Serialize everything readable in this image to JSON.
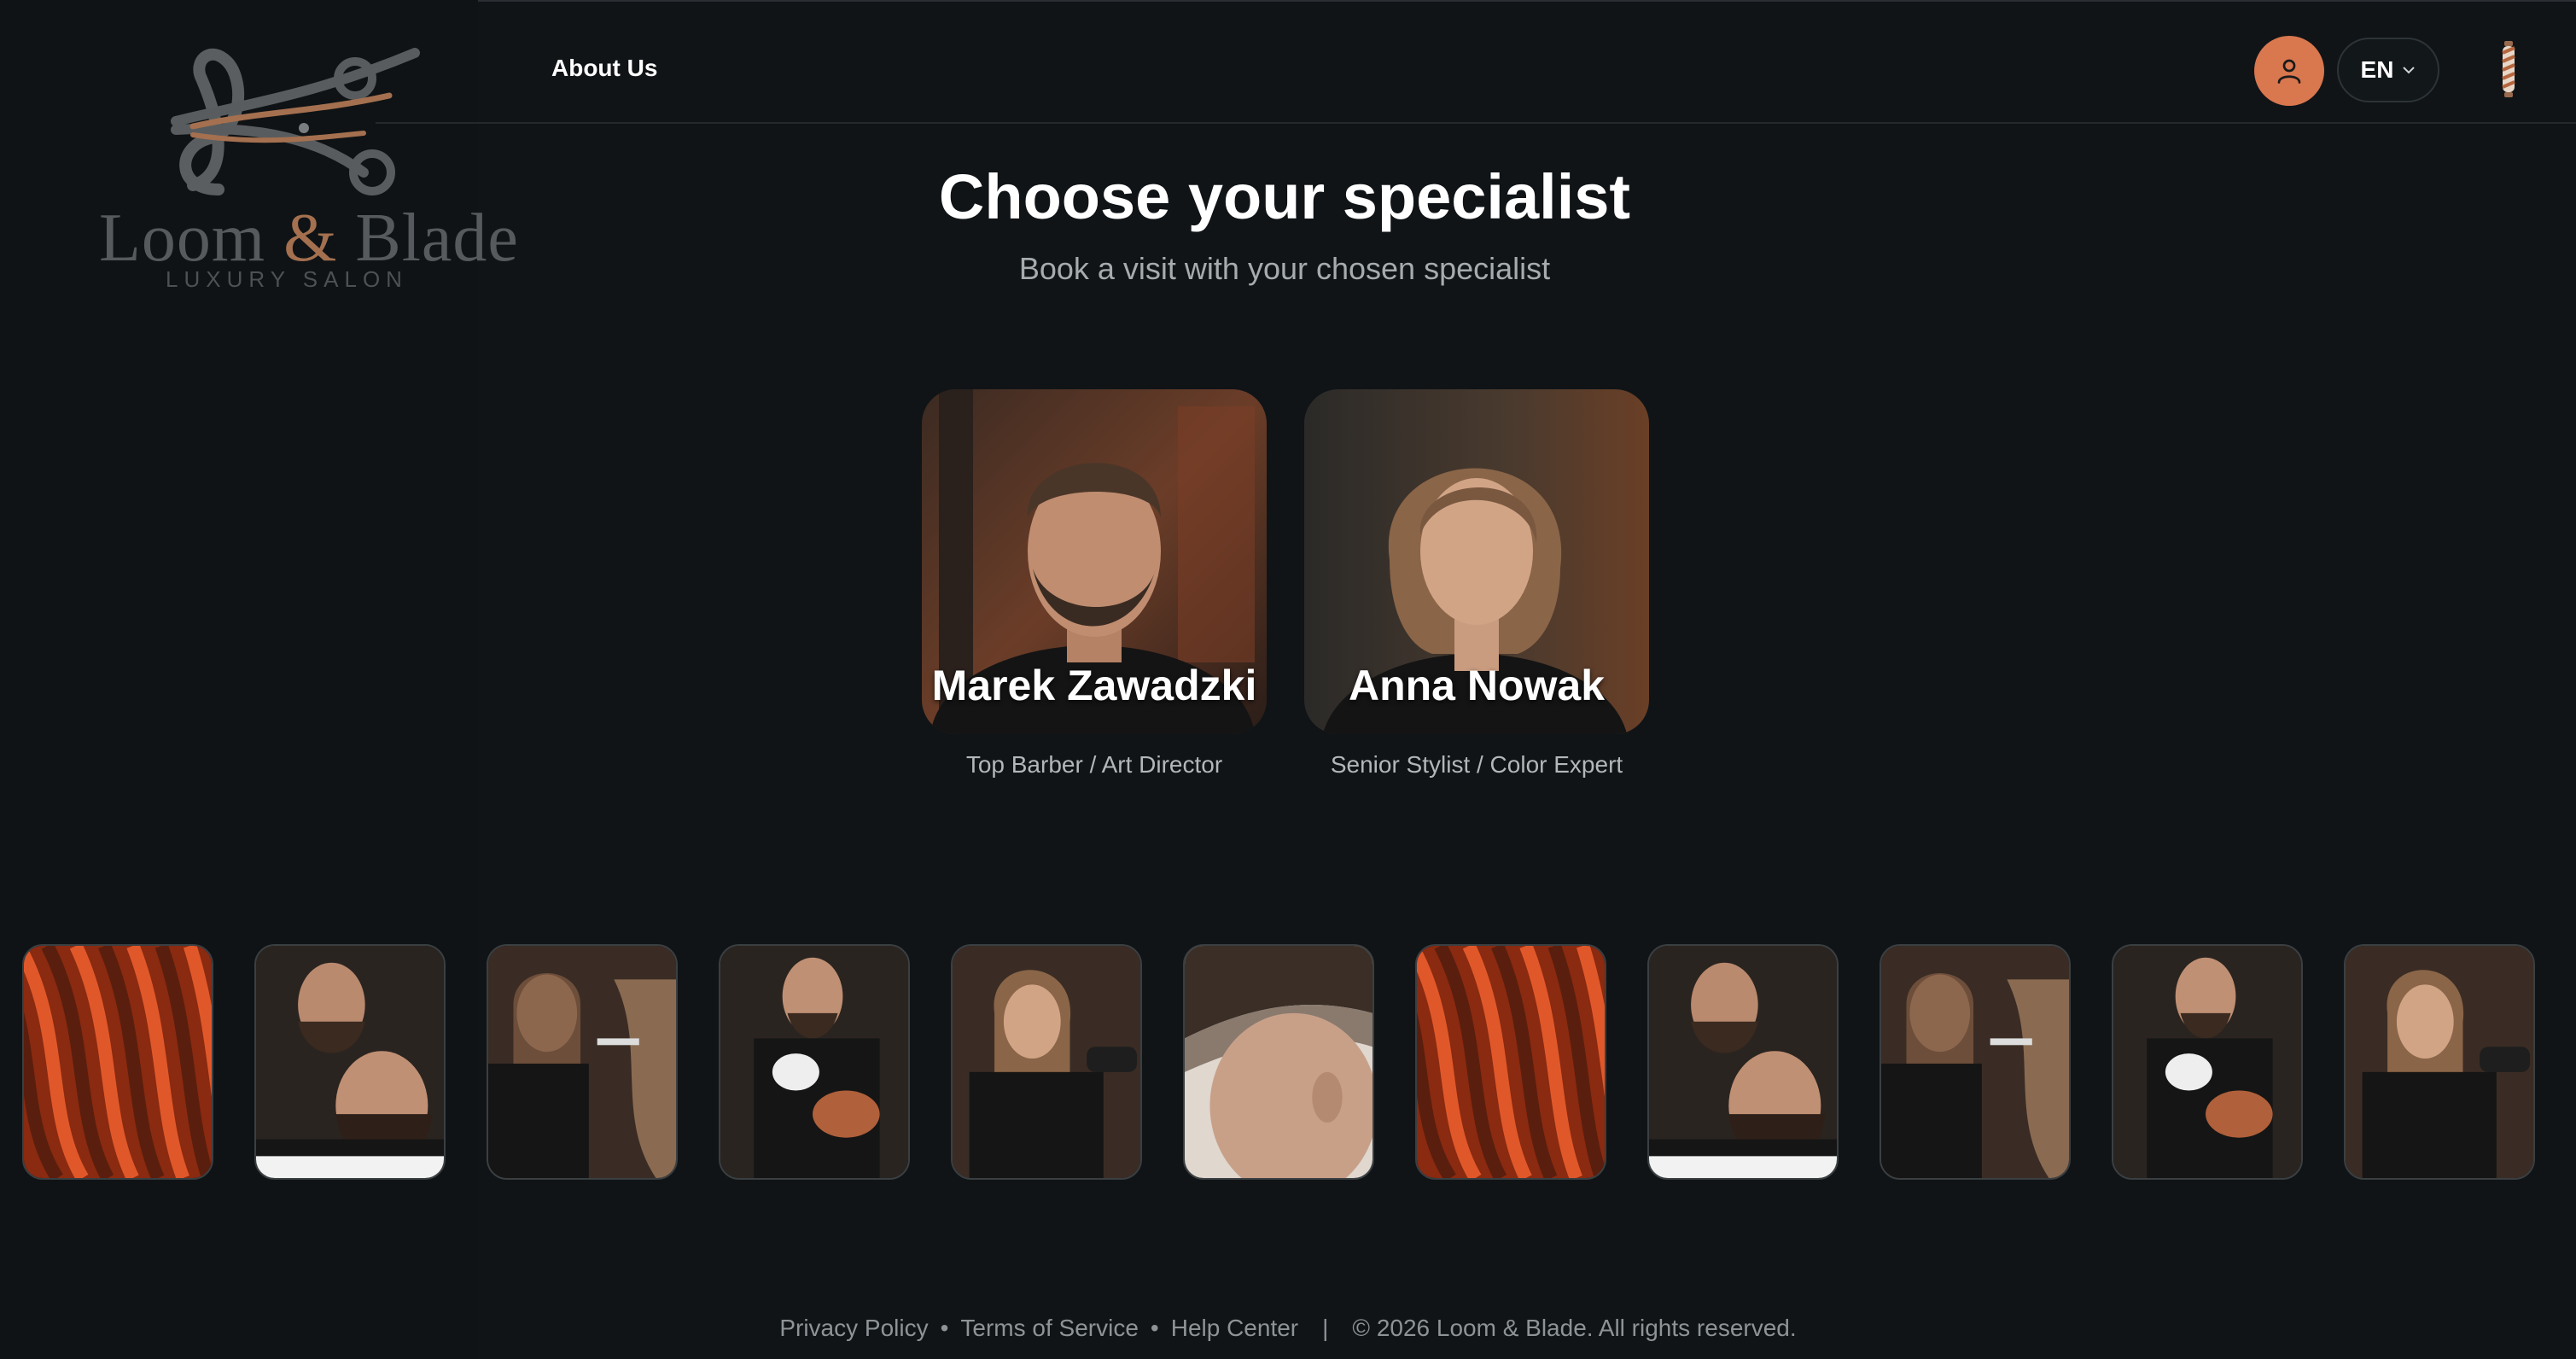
{
  "brand": {
    "name_part1": "Loom",
    "ampersand": "&",
    "name_part2": "Blade",
    "tagline": "LUXURY SALON"
  },
  "nav": {
    "about_label": "About Us"
  },
  "header": {
    "language": "EN",
    "user_icon": "user-icon",
    "barber_pole_icon": "barber-pole-icon"
  },
  "main": {
    "title": "Choose your specialist",
    "subtitle": "Book a visit with your chosen specialist"
  },
  "specialists": [
    {
      "name": "Marek Zawadzki",
      "role": "Top Barber / Art Director"
    },
    {
      "name": "Anna Nowak",
      "role": "Senior Stylist / Color Expert"
    }
  ],
  "gallery": [
    "red-hair-photo",
    "beard-trim-photo",
    "hair-coloring-photo",
    "color-mixing-photo",
    "blow-dry-photo",
    "fade-haircut-photo",
    "red-hair-photo",
    "beard-trim-photo",
    "hair-coloring-photo",
    "color-mixing-photo",
    "blow-dry-photo"
  ],
  "footer": {
    "privacy": "Privacy Policy",
    "dot1": "•",
    "terms": "Terms of Service",
    "dot2": "•",
    "help": "Help Center",
    "divider": "|",
    "copyright": "© 2026 Loom & Blade. All rights reserved."
  },
  "colors": {
    "background": "#101417",
    "accent": "#d9774f",
    "muted_text": "#a6abae"
  }
}
